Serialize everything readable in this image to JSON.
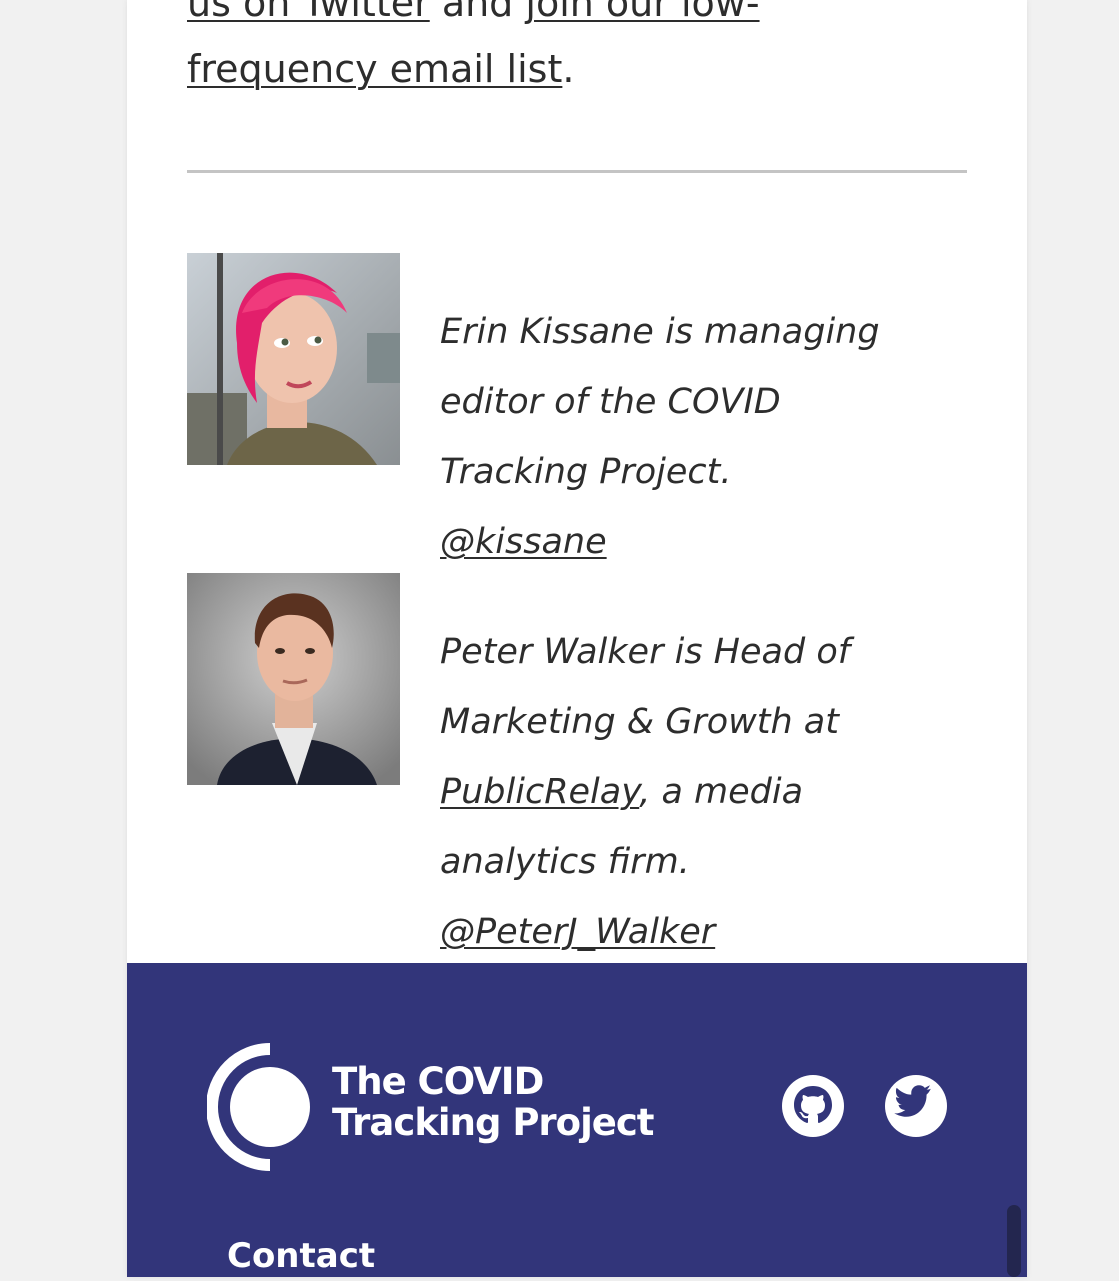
{
  "intro": {
    "link_twitter": "us on Twitter",
    "and_text": " and ",
    "link_email_part1": "join our low-",
    "link_email_part2": "frequency email list",
    "period": "."
  },
  "authors": [
    {
      "bio": "Erin Kissane is managing editor of the COVID Tracking Project.",
      "handle": "@kissane"
    },
    {
      "bio_before": "Peter Walker is Head of Marketing & Growth at ",
      "bio_link": "PublicRelay",
      "bio_after": ", a media analytics firm.",
      "handle": "@PeterJ_Walker"
    }
  ],
  "footer": {
    "logo_line1": "The COVID",
    "logo_line2": "Tracking Project",
    "contact_heading": "Contact",
    "social": [
      "github-icon",
      "twitter-icon"
    ]
  },
  "colors": {
    "footer_bg": "#32357a",
    "text": "#2d2d2d",
    "divider": "#c4c4c4"
  }
}
